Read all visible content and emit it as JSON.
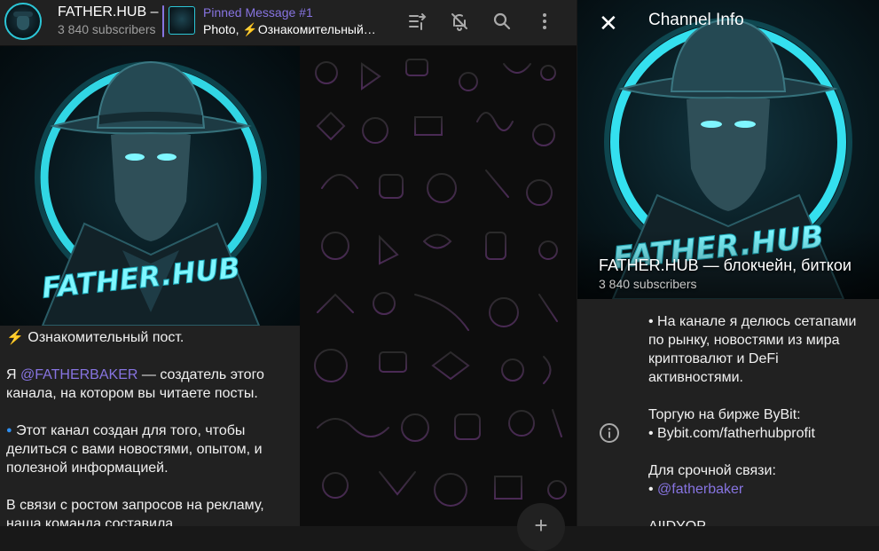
{
  "header": {
    "channel_title": "FATHER.HUB –",
    "subscribers": "3 840 subscribers",
    "pinned": {
      "title": "Pinned Message #1",
      "prefix": "Photo, ",
      "text": "Ознакомительный…"
    },
    "icons": [
      "pinned-list-icon",
      "bell-off-icon",
      "search-icon",
      "more-vert-icon"
    ]
  },
  "post": {
    "image_logo_text": "FATHER.HUB",
    "lines": [
      {
        "text": "Ознакомительный пост.",
        "emoji": "⚡"
      },
      {
        "gap": true
      },
      {
        "pre": "Я ",
        "mention": "@FATHERBAKER",
        "post": " — создатель этого канала, на котором вы читаете посты."
      },
      {
        "gap": true
      },
      {
        "emoji": "🔵",
        "text": "Этот канал создан для того, чтобы делиться с вами новостями, опытом, и полезной информацией."
      },
      {
        "gap": true
      },
      {
        "text": "В связи с ростом запросов на рекламу, наша команда составила"
      }
    ]
  },
  "panel": {
    "heading": "Channel Info",
    "name": "FATHER.HUB — блокчейн, биткои",
    "subscribers": "3 840 subscribers",
    "hero_logo_text": "FATHER.HUB",
    "desc_line1": "• На канале я делюсь сетапами по рынку, новостями из мира криптовалют и DeFi активностями.",
    "desc_line2": "Торгую на бирже ByBit:",
    "desc_line3": "• Bybit.com/fatherhubprofit",
    "desc_line4": "Для срочной связи:",
    "desc_bullet": "• ",
    "desc_mention": "@fatherbaker",
    "desc_line5": "AIIDYOP"
  },
  "colors": {
    "accent": "#8774e1",
    "neon": "#2cc6d6",
    "panel_bg": "#212121"
  }
}
